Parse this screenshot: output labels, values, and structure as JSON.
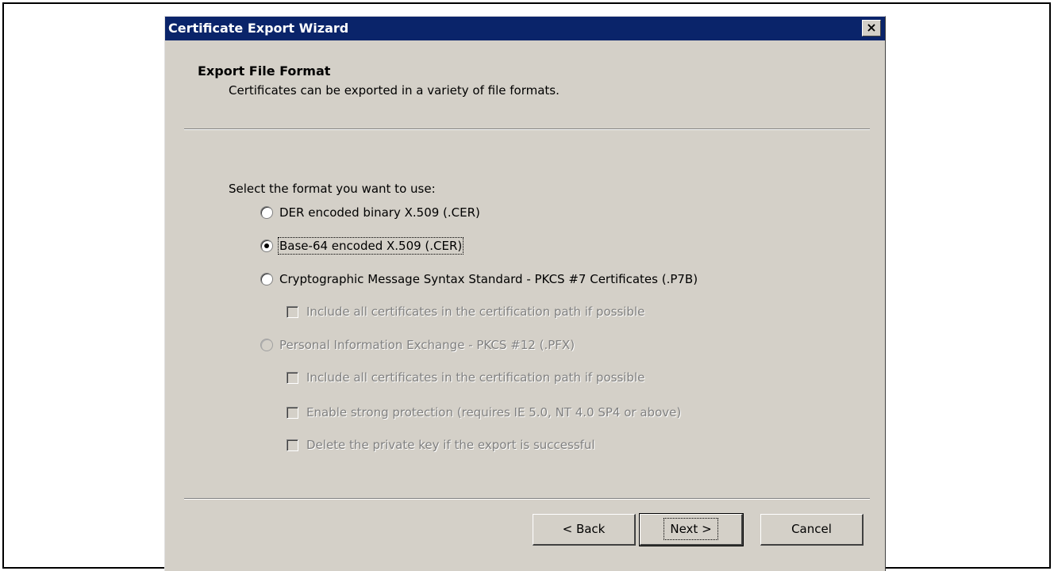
{
  "window": {
    "title": "Certificate Export Wizard",
    "close_glyph": "×"
  },
  "header": {
    "title": "Export File Format",
    "subtitle": "Certificates can be exported in a variety of file formats."
  },
  "prompt": "Select the format you want to use:",
  "options": {
    "der": {
      "label": "DER encoded binary X.509 (.CER)",
      "selected": false,
      "enabled": true
    },
    "base64": {
      "label": "Base-64 encoded X.509 (.CER)",
      "selected": true,
      "enabled": true
    },
    "pkcs7": {
      "label": "Cryptographic Message Syntax Standard - PKCS #7 Certificates (.P7B)",
      "selected": false,
      "enabled": true
    },
    "pkcs7_include": {
      "label": "Include all certificates in the certification path if possible",
      "checked": false,
      "enabled": false
    },
    "pfx": {
      "label": "Personal Information Exchange - PKCS #12 (.PFX)",
      "selected": false,
      "enabled": false
    },
    "pfx_include": {
      "label": "Include all certificates in the certification path if possible",
      "checked": false,
      "enabled": false
    },
    "pfx_strong": {
      "label": "Enable strong protection (requires IE 5.0, NT 4.0 SP4 or above)",
      "checked": false,
      "enabled": false
    },
    "pfx_delete": {
      "label": "Delete the private key if the export is successful",
      "checked": false,
      "enabled": false
    }
  },
  "buttons": {
    "back": "< Back",
    "next": "Next >",
    "cancel": "Cancel"
  }
}
